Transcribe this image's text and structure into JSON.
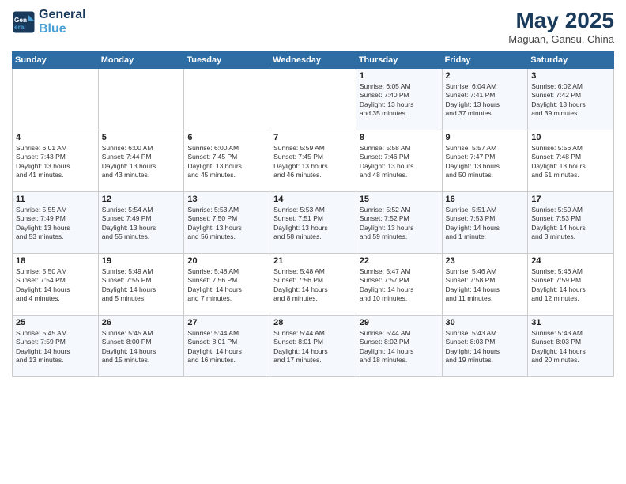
{
  "header": {
    "logo_line1": "General",
    "logo_line2": "Blue",
    "month": "May 2025",
    "location": "Maguan, Gansu, China"
  },
  "weekdays": [
    "Sunday",
    "Monday",
    "Tuesday",
    "Wednesday",
    "Thursday",
    "Friday",
    "Saturday"
  ],
  "weeks": [
    [
      {
        "day": "",
        "text": ""
      },
      {
        "day": "",
        "text": ""
      },
      {
        "day": "",
        "text": ""
      },
      {
        "day": "",
        "text": ""
      },
      {
        "day": "1",
        "text": "Sunrise: 6:05 AM\nSunset: 7:40 PM\nDaylight: 13 hours\nand 35 minutes."
      },
      {
        "day": "2",
        "text": "Sunrise: 6:04 AM\nSunset: 7:41 PM\nDaylight: 13 hours\nand 37 minutes."
      },
      {
        "day": "3",
        "text": "Sunrise: 6:02 AM\nSunset: 7:42 PM\nDaylight: 13 hours\nand 39 minutes."
      }
    ],
    [
      {
        "day": "4",
        "text": "Sunrise: 6:01 AM\nSunset: 7:43 PM\nDaylight: 13 hours\nand 41 minutes."
      },
      {
        "day": "5",
        "text": "Sunrise: 6:00 AM\nSunset: 7:44 PM\nDaylight: 13 hours\nand 43 minutes."
      },
      {
        "day": "6",
        "text": "Sunrise: 6:00 AM\nSunset: 7:45 PM\nDaylight: 13 hours\nand 45 minutes."
      },
      {
        "day": "7",
        "text": "Sunrise: 5:59 AM\nSunset: 7:45 PM\nDaylight: 13 hours\nand 46 minutes."
      },
      {
        "day": "8",
        "text": "Sunrise: 5:58 AM\nSunset: 7:46 PM\nDaylight: 13 hours\nand 48 minutes."
      },
      {
        "day": "9",
        "text": "Sunrise: 5:57 AM\nSunset: 7:47 PM\nDaylight: 13 hours\nand 50 minutes."
      },
      {
        "day": "10",
        "text": "Sunrise: 5:56 AM\nSunset: 7:48 PM\nDaylight: 13 hours\nand 51 minutes."
      }
    ],
    [
      {
        "day": "11",
        "text": "Sunrise: 5:55 AM\nSunset: 7:49 PM\nDaylight: 13 hours\nand 53 minutes."
      },
      {
        "day": "12",
        "text": "Sunrise: 5:54 AM\nSunset: 7:49 PM\nDaylight: 13 hours\nand 55 minutes."
      },
      {
        "day": "13",
        "text": "Sunrise: 5:53 AM\nSunset: 7:50 PM\nDaylight: 13 hours\nand 56 minutes."
      },
      {
        "day": "14",
        "text": "Sunrise: 5:53 AM\nSunset: 7:51 PM\nDaylight: 13 hours\nand 58 minutes."
      },
      {
        "day": "15",
        "text": "Sunrise: 5:52 AM\nSunset: 7:52 PM\nDaylight: 13 hours\nand 59 minutes."
      },
      {
        "day": "16",
        "text": "Sunrise: 5:51 AM\nSunset: 7:53 PM\nDaylight: 14 hours\nand 1 minute."
      },
      {
        "day": "17",
        "text": "Sunrise: 5:50 AM\nSunset: 7:53 PM\nDaylight: 14 hours\nand 3 minutes."
      }
    ],
    [
      {
        "day": "18",
        "text": "Sunrise: 5:50 AM\nSunset: 7:54 PM\nDaylight: 14 hours\nand 4 minutes."
      },
      {
        "day": "19",
        "text": "Sunrise: 5:49 AM\nSunset: 7:55 PM\nDaylight: 14 hours\nand 5 minutes."
      },
      {
        "day": "20",
        "text": "Sunrise: 5:48 AM\nSunset: 7:56 PM\nDaylight: 14 hours\nand 7 minutes."
      },
      {
        "day": "21",
        "text": "Sunrise: 5:48 AM\nSunset: 7:56 PM\nDaylight: 14 hours\nand 8 minutes."
      },
      {
        "day": "22",
        "text": "Sunrise: 5:47 AM\nSunset: 7:57 PM\nDaylight: 14 hours\nand 10 minutes."
      },
      {
        "day": "23",
        "text": "Sunrise: 5:46 AM\nSunset: 7:58 PM\nDaylight: 14 hours\nand 11 minutes."
      },
      {
        "day": "24",
        "text": "Sunrise: 5:46 AM\nSunset: 7:59 PM\nDaylight: 14 hours\nand 12 minutes."
      }
    ],
    [
      {
        "day": "25",
        "text": "Sunrise: 5:45 AM\nSunset: 7:59 PM\nDaylight: 14 hours\nand 13 minutes."
      },
      {
        "day": "26",
        "text": "Sunrise: 5:45 AM\nSunset: 8:00 PM\nDaylight: 14 hours\nand 15 minutes."
      },
      {
        "day": "27",
        "text": "Sunrise: 5:44 AM\nSunset: 8:01 PM\nDaylight: 14 hours\nand 16 minutes."
      },
      {
        "day": "28",
        "text": "Sunrise: 5:44 AM\nSunset: 8:01 PM\nDaylight: 14 hours\nand 17 minutes."
      },
      {
        "day": "29",
        "text": "Sunrise: 5:44 AM\nSunset: 8:02 PM\nDaylight: 14 hours\nand 18 minutes."
      },
      {
        "day": "30",
        "text": "Sunrise: 5:43 AM\nSunset: 8:03 PM\nDaylight: 14 hours\nand 19 minutes."
      },
      {
        "day": "31",
        "text": "Sunrise: 5:43 AM\nSunset: 8:03 PM\nDaylight: 14 hours\nand 20 minutes."
      }
    ]
  ]
}
